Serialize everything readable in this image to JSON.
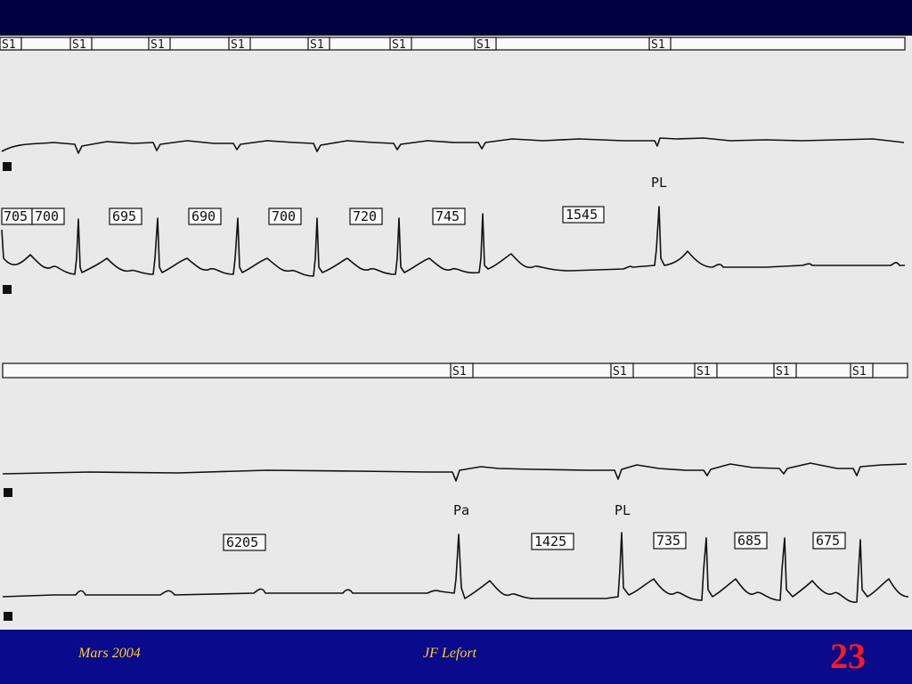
{
  "strip1": {
    "marker_label": "S1",
    "intervals": [
      "705",
      "700",
      "695",
      "690",
      "700",
      "720",
      "745",
      "1545"
    ],
    "beat_label": "PL"
  },
  "strip2": {
    "marker_label": "S1",
    "intervals": [
      "6205",
      "1425",
      "735",
      "685",
      "675"
    ],
    "beat_labels": [
      "Pa",
      "PL"
    ]
  },
  "footer": {
    "date": "Mars 2004",
    "author": "JF Lefort",
    "slide_number": "23"
  },
  "colors": {
    "background": "#000040",
    "panel": "#e9e9e9",
    "footer": "#0a0a8c",
    "footer_text": "#ffd21f",
    "slide_number": "#ff1a1a"
  }
}
